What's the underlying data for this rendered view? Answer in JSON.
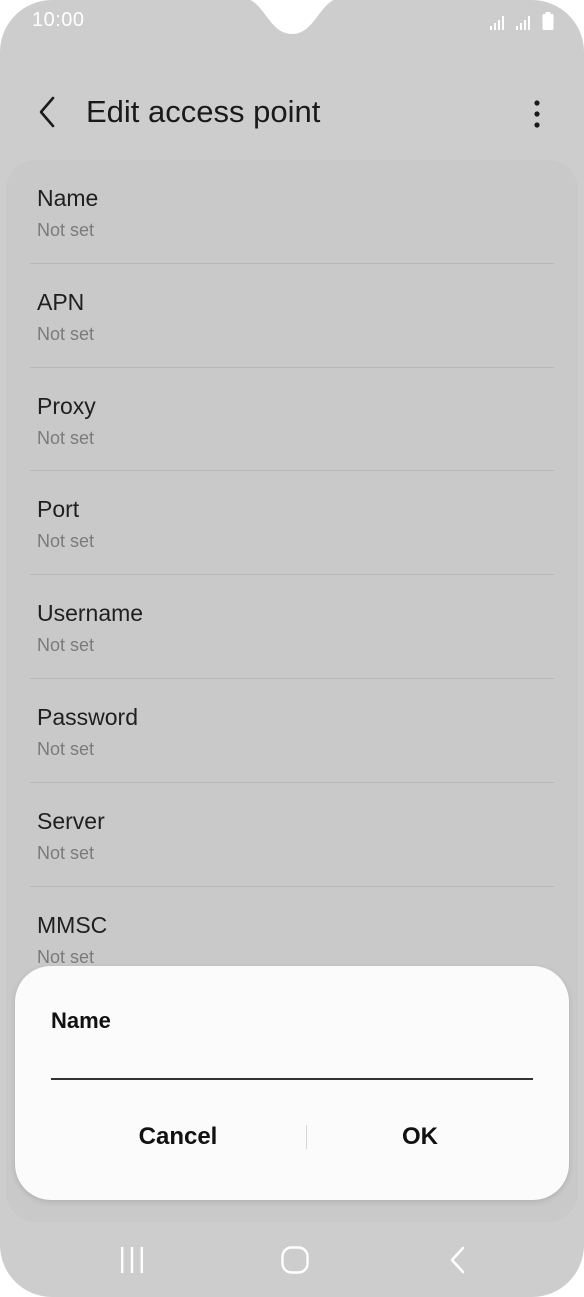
{
  "status_bar": {
    "time": "10:00"
  },
  "app_bar": {
    "title": "Edit access point",
    "back_icon": "chevron-left-icon",
    "more_icon": "more-vert-icon"
  },
  "list": {
    "items": [
      {
        "title": "Name",
        "value": "Not set"
      },
      {
        "title": "APN",
        "value": "Not set"
      },
      {
        "title": "Proxy",
        "value": "Not set"
      },
      {
        "title": "Port",
        "value": "Not set"
      },
      {
        "title": "Username",
        "value": "Not set"
      },
      {
        "title": "Password",
        "value": "Not set"
      },
      {
        "title": "Server",
        "value": "Not set"
      },
      {
        "title": "MMSC",
        "value": "Not set"
      }
    ]
  },
  "dialog": {
    "title": "Name",
    "input_value": "",
    "cancel_label": "Cancel",
    "ok_label": "OK"
  },
  "nav_bar": {
    "recents_icon": "recents-icon",
    "home_icon": "home-icon",
    "back_icon": "back-icon"
  },
  "colors": {
    "background": "#cdcdcd",
    "dialog": "#fbfbfb",
    "text_primary": "#1f1f1f",
    "text_secondary": "#7b7b7b"
  }
}
